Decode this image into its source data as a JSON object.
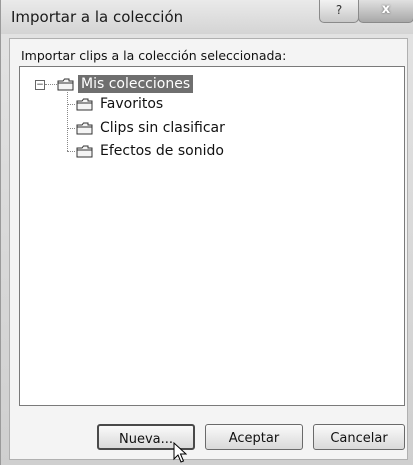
{
  "window": {
    "title": "Importar a la colección",
    "help_label": "?",
    "close_label": "x"
  },
  "dialog": {
    "instruction": "Importar clips a la colección seleccionada:"
  },
  "tree": {
    "root_label": "Mis colecciones",
    "expander_symbol": "−",
    "children": [
      {
        "label": "Favoritos"
      },
      {
        "label": "Clips sin clasificar"
      },
      {
        "label": "Efectos de sonido"
      }
    ]
  },
  "buttons": {
    "nueva": "Nueva...",
    "aceptar": "Aceptar",
    "cancelar": "Cancelar"
  },
  "icons": {
    "folder": "folder-icon",
    "cursor": "mouse-pointer-icon"
  }
}
